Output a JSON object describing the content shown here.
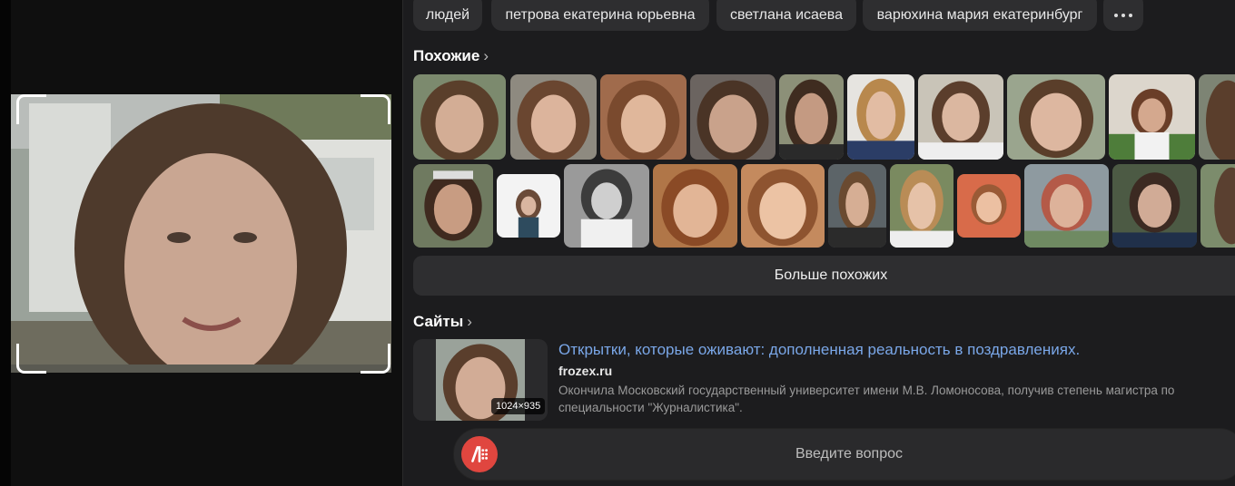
{
  "chips": [
    {
      "label": "людей"
    },
    {
      "label": "петрова екатерина юрьевна"
    },
    {
      "label": "светлана исаева"
    },
    {
      "label": "варюхина мария екатеринбург"
    }
  ],
  "similar": {
    "title": "Похожие",
    "more_button": "Больше похожих"
  },
  "sites": {
    "title": "Сайты",
    "result": {
      "title": "Открытки, которые оживают: дополненная реальность в поздравлениях.",
      "domain": "frozex.ru",
      "snippet": "Окончила Московский государственный университет имени М.В. Ломоносова, получив степень магистра по специальности \"Журналистика\".",
      "image_size": "1024×935"
    }
  },
  "ask": {
    "placeholder": "Введите вопрос"
  },
  "icons": {
    "more": "more-dots-icon",
    "chevron": "chevron-right-icon",
    "assistant": "alice-assistant-icon"
  },
  "colors": {
    "background": "#1c1c1e",
    "surface": "#2e2e30",
    "link": "#7aa7e8",
    "assistant": "#e0463f"
  }
}
